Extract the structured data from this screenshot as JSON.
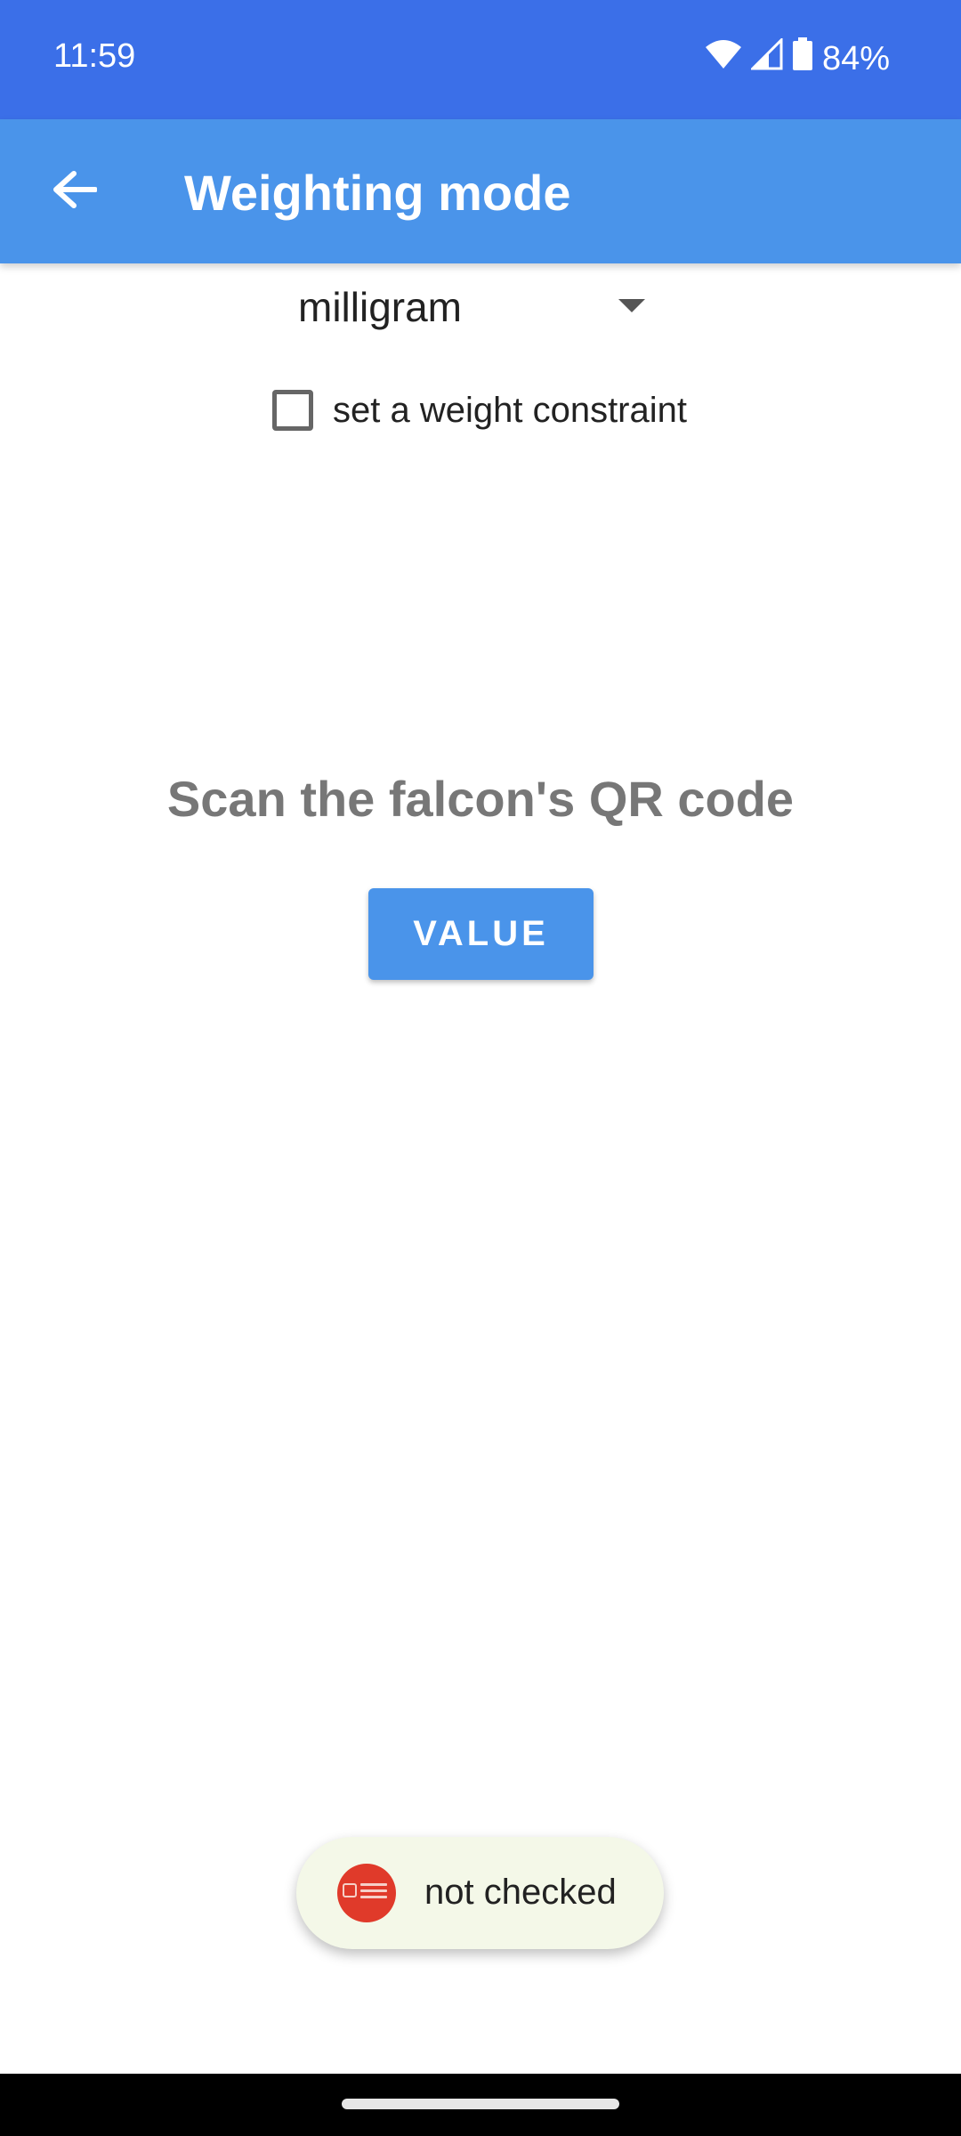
{
  "status_bar": {
    "time": "11:59",
    "battery_percent": "84%",
    "icons": [
      "wifi-icon",
      "signal-icon",
      "battery-icon"
    ]
  },
  "app_bar": {
    "title": "Weighting mode",
    "back_icon": "arrow-back-icon"
  },
  "unit_spinner": {
    "selected": "milligram"
  },
  "constraint_checkbox": {
    "label": "set a weight constraint",
    "checked": false
  },
  "scan": {
    "heading": "Scan the falcon's QR code",
    "button_label": "VALUE"
  },
  "toast": {
    "message": "not checked",
    "icon": "app-logo-icon"
  },
  "colors": {
    "status_bar": "#3b6fe8",
    "app_bar": "#4a94ea",
    "button": "#4a94ea",
    "toast_bg": "#f4f8e8",
    "logo": "#e03a2a"
  }
}
